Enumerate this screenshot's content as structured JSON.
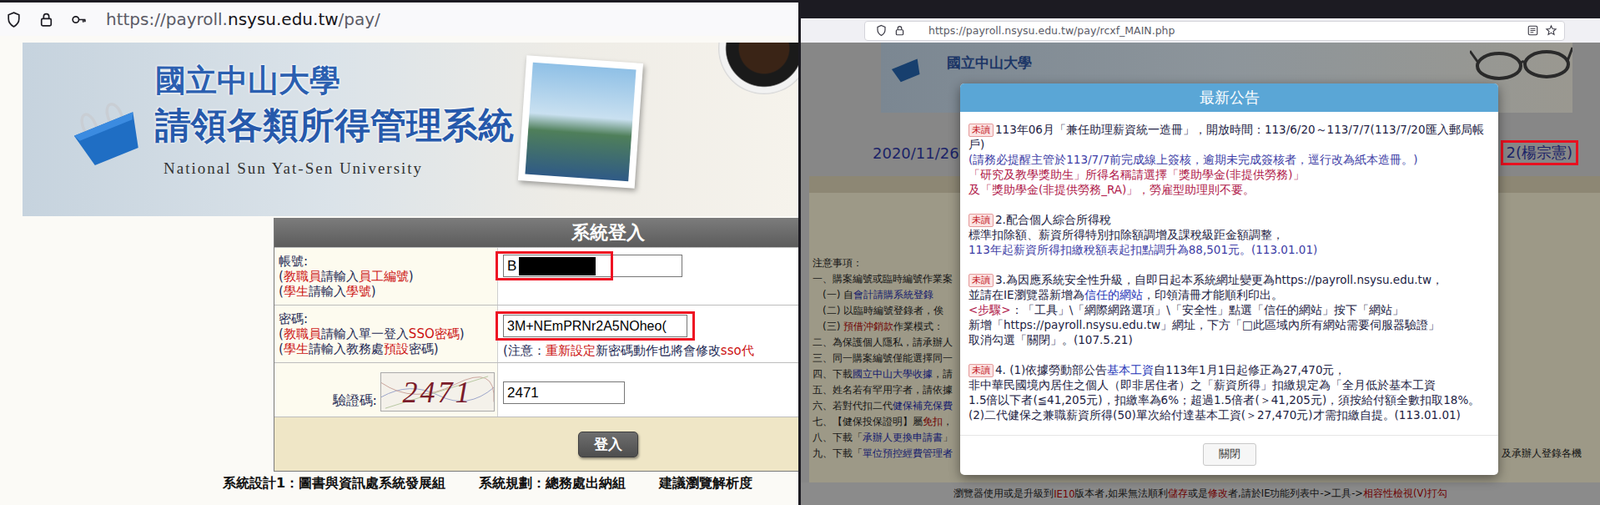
{
  "left_window": {
    "url": [
      {
        "text": "https://payroll.",
        "kind": "dim"
      },
      {
        "text": "nsysu.edu.tw",
        "kind": "domain"
      },
      {
        "text": "/pay/",
        "kind": "dim"
      }
    ],
    "banner": {
      "title": "國立中山大學",
      "subtitle": "請領各類所得管理系統",
      "english": "National Sun Yat-Sen University"
    },
    "login": {
      "title": "系統登入",
      "fields": [
        {
          "kind": "account",
          "label": "帳號:",
          "hints": [
            [
              {
                "text": "(",
                "kind": "plain"
              },
              {
                "text": "教職員",
                "kind": "alert"
              },
              {
                "text": "請輸入",
                "kind": "plain"
              },
              {
                "text": "員工編號",
                "kind": "alert"
              },
              {
                "text": ")",
                "kind": "plain"
              }
            ],
            [
              {
                "text": "(",
                "kind": "plain"
              },
              {
                "text": "學生",
                "kind": "alert"
              },
              {
                "text": "請輸入",
                "kind": "plain"
              },
              {
                "text": "學號",
                "kind": "alert"
              },
              {
                "text": ")",
                "kind": "plain"
              }
            ]
          ],
          "value": "B",
          "redacted": true,
          "highlighted": true
        },
        {
          "kind": "password",
          "label": "密碼:",
          "hints": [
            [
              {
                "text": "(",
                "kind": "plain"
              },
              {
                "text": "教職員",
                "kind": "alert"
              },
              {
                "text": "請輸入單一登入",
                "kind": "plain"
              },
              {
                "text": "SSO密碼",
                "kind": "alert"
              },
              {
                "text": ")",
                "kind": "plain"
              }
            ],
            [
              {
                "text": "(",
                "kind": "plain"
              },
              {
                "text": "學生",
                "kind": "alert"
              },
              {
                "text": "請輸入教務處",
                "kind": "plain"
              },
              {
                "text": "預設",
                "kind": "alert"
              },
              {
                "text": "密碼)",
                "kind": "plain"
              }
            ]
          ],
          "value": "3M+NEmPRNr2A5NOheo(",
          "redacted": false,
          "highlighted": true,
          "note": [
            {
              "text": "(注意：",
              "kind": "plain"
            },
            {
              "text": "重新設定",
              "kind": "alert"
            },
            {
              "text": "新密碼動作也將會修改",
              "kind": "plain"
            },
            {
              "text": "sso代",
              "kind": "alert"
            }
          ]
        },
        {
          "kind": "captcha",
          "label": "驗證碼:",
          "captcha": "2471",
          "value": "2471",
          "redacted": false,
          "highlighted": false
        }
      ],
      "button": "登入"
    },
    "footer": [
      "系統設計1：圖書與資訊處系統發展組",
      "系統規劃：總務處出納組",
      "建議瀏覽解析度"
    ]
  },
  "right_window": {
    "url": "https://payroll.nsysu.edu.tw/pay/rcxf_MAIN.php",
    "banner_title": "國立中山大學",
    "date": "2020/11/26",
    "user": {
      "text": "2(楊宗憲)",
      "highlighted": true
    },
    "notes": [
      {
        "indent": false,
        "segments": [
          {
            "text": "注意事項：",
            "kind": "plain"
          }
        ]
      },
      {
        "indent": false,
        "segments": [
          {
            "text": "一、購案編號或臨時編號作業案",
            "kind": "plain"
          }
        ]
      },
      {
        "indent": true,
        "segments": [
          {
            "text": "(一) 自",
            "kind": "plain"
          },
          {
            "text": "會計請購系統登錄",
            "kind": "link"
          }
        ]
      },
      {
        "indent": true,
        "segments": [
          {
            "text": "(二) 以臨時編號登錄者，俟",
            "kind": "plain"
          }
        ]
      },
      {
        "indent": true,
        "segments": [
          {
            "text": "(三) ",
            "kind": "plain"
          },
          {
            "text": "預借沖銷款",
            "kind": "alert"
          },
          {
            "text": "作業模式：",
            "kind": "plain"
          }
        ]
      },
      {
        "indent": false,
        "segments": [
          {
            "text": "二、為保護個人隱私，請承辦人",
            "kind": "plain"
          }
        ]
      },
      {
        "indent": false,
        "segments": [
          {
            "text": "三、同一購案編號僅能選擇同一",
            "kind": "plain"
          }
        ]
      },
      {
        "indent": false,
        "segments": [
          {
            "text": "四、下載",
            "kind": "plain"
          },
          {
            "text": "國立中山大學收據",
            "kind": "link"
          },
          {
            "text": "，請",
            "kind": "plain"
          }
        ]
      },
      {
        "indent": false,
        "segments": [
          {
            "text": "五、姓名若有罕用字者，請依據",
            "kind": "plain"
          }
        ]
      },
      {
        "indent": false,
        "segments": [
          {
            "text": "六、若對代扣二代",
            "kind": "plain"
          },
          {
            "text": "健保補充保費",
            "kind": "link"
          }
        ]
      },
      {
        "indent": false,
        "segments": [
          {
            "text": "七、【健保投保證明】屬",
            "kind": "plain"
          },
          {
            "text": "免扣",
            "kind": "alert"
          },
          {
            "text": "，",
            "kind": "plain"
          }
        ]
      },
      {
        "indent": false,
        "segments": [
          {
            "text": "八、下載「",
            "kind": "plain"
          },
          {
            "text": "承辦人更換申請書",
            "kind": "link"
          },
          {
            "text": "」",
            "kind": "plain"
          }
        ]
      },
      {
        "indent": false,
        "segments": [
          {
            "text": "九、下載「",
            "kind": "plain"
          },
          {
            "text": "單位預控經費管理者",
            "kind": "link"
          }
        ]
      }
    ],
    "notes_right": "及承辦人登錄各機",
    "bottom_notice": [
      {
        "text": "瀏覽器使用或是升級到",
        "kind": "plain"
      },
      {
        "text": "IE10",
        "kind": "alert"
      },
      {
        "text": "版本者,如果無法順利",
        "kind": "plain"
      },
      {
        "text": "儲存",
        "kind": "alert"
      },
      {
        "text": "或是",
        "kind": "plain"
      },
      {
        "text": "修改",
        "kind": "alert"
      },
      {
        "text": "者,請於IE功能列表中->工具->",
        "kind": "plain"
      },
      {
        "text": "相容性檢視(V)打勾",
        "kind": "alert"
      }
    ],
    "dialog": {
      "title": "最新公告",
      "close": "關閉",
      "items": [
        {
          "badge": "未讀",
          "read": false,
          "lines": [
            [
              {
                "text": "113年06月「兼任助理薪資統一造冊」，開放時間：113/6/20～113/7/7(113/7/20匯入郵局帳戶)",
                "kind": "plain"
              }
            ],
            [
              {
                "text": "(請務必提醒主管於113/7/7前完成線上簽核，逾期未完成簽核者，逕行改為紙本造冊。)",
                "kind": "note"
              }
            ],
            [
              {
                "text": "「研究及教學獎助生」所得名稱請選擇「獎助學金(非提供勞務)」",
                "kind": "alert"
              }
            ],
            [
              {
                "text": "及「獎助學金(非提供勞務_RA)」，勞雇型助理則不要。",
                "kind": "alert"
              }
            ]
          ]
        },
        {
          "badge": "未讀",
          "read": false,
          "lines": [
            [
              {
                "text": "2.配合個人綜合所得稅",
                "kind": "plain"
              }
            ],
            [
              {
                "text": "標準扣除額、薪資所得特別扣除額調增及課稅級距金額調整，",
                "kind": "plain"
              }
            ],
            [
              {
                "text": "113年起薪資所得扣繳稅額表起扣點調升為88,501元。(113.01.01)",
                "kind": "note"
              }
            ]
          ]
        },
        {
          "badge": "未讀",
          "read": false,
          "lines": [
            [
              {
                "text": "3.為因應系統安全性升級，自即日起本系統網址變更為https://payroll.nsysu.edu.tw，",
                "kind": "plain"
              }
            ],
            [
              {
                "text": "並請在IE瀏覽器新增為",
                "kind": "plain"
              },
              {
                "text": "信任的網站",
                "kind": "link"
              },
              {
                "text": "，印領清冊才能順利印出。",
                "kind": "plain"
              }
            ],
            [
              {
                "text": "<步驟>",
                "kind": "alert"
              },
              {
                "text": "：「工具」\\「網際網路選項」\\「安全性」點選「信任的網站」按下「網站」",
                "kind": "plain"
              }
            ],
            [
              {
                "text": "新增「https://payroll.nsysu.edu.tw」網址，下方「□此區域內所有網站需要伺服器驗證」",
                "kind": "plain"
              }
            ],
            [
              {
                "text": "取消勾選「關閉」。(107.5.21)",
                "kind": "plain"
              }
            ]
          ]
        },
        {
          "badge": "未讀",
          "read": false,
          "lines": [
            [
              {
                "text": "4. (1)依據勞動部公告",
                "kind": "plain"
              },
              {
                "text": "基本工資",
                "kind": "link"
              },
              {
                "text": "自113年1月1日起修正為27,470元，",
                "kind": "plain"
              }
            ],
            [
              {
                "text": "非中華民國境內居住之個人（即非居住者）之「薪資所得」扣繳規定為「全月低於基本工資",
                "kind": "plain"
              }
            ],
            [
              {
                "text": "1.5倍以下者(≦41,205元)，扣繳率為6%；超過1.5倍者(＞41,205元)，須按給付額全數扣取18%。",
                "kind": "plain"
              }
            ],
            [
              {
                "text": "(2)二代健保之兼職薪資所得(50)單次給付達基本工資(＞27,470元)才需扣繳自提。(113.01.01)",
                "kind": "plain"
              }
            ]
          ]
        }
      ]
    }
  }
}
